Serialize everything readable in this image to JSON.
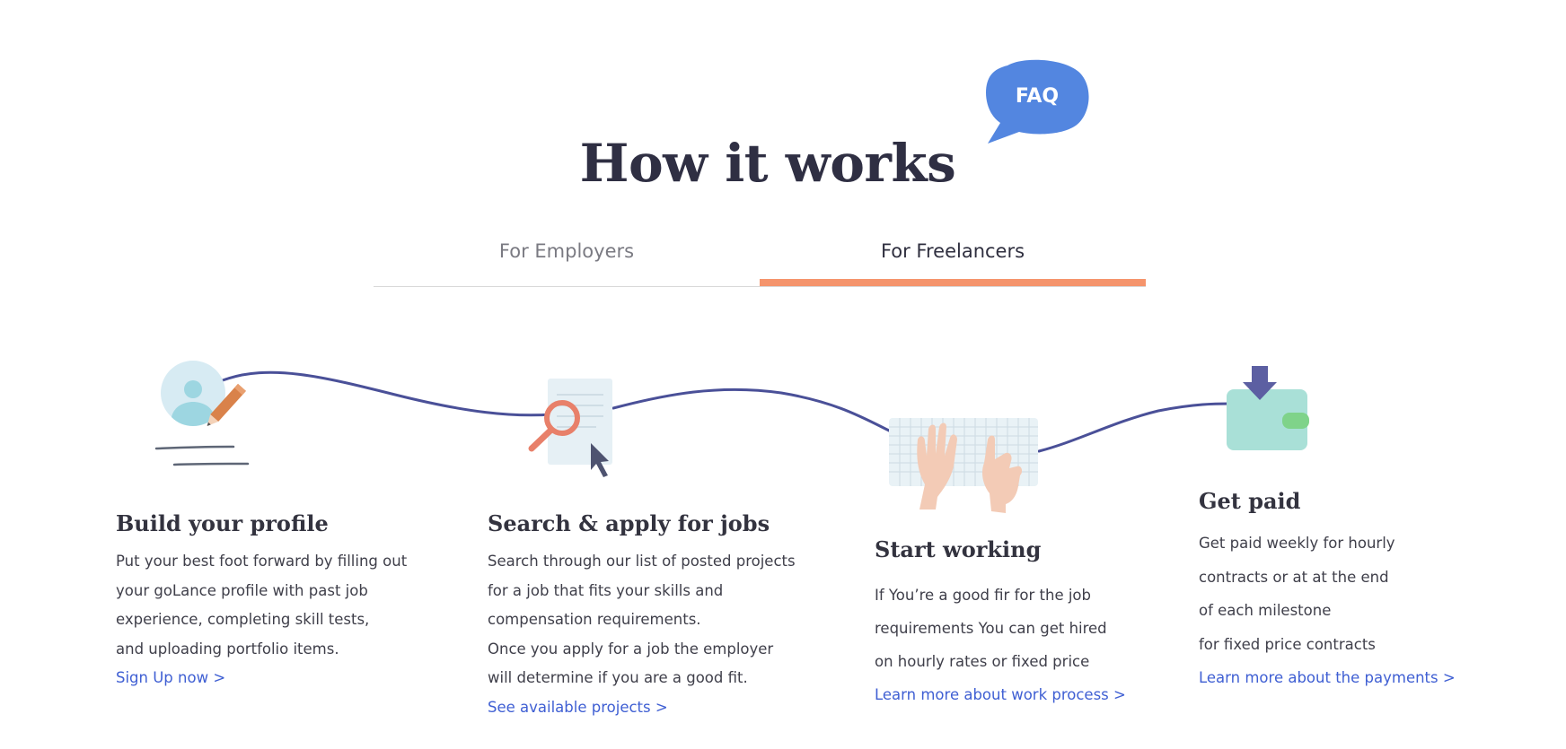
{
  "faq": {
    "label": "FAQ"
  },
  "page": {
    "title": "How it works"
  },
  "tabs": [
    {
      "label": "For Employers",
      "active": false
    },
    {
      "label": "For Freelancers",
      "active": true
    }
  ],
  "colors": {
    "accent": "#f5946c",
    "link": "#3f5fd3",
    "faq_bubble": "#5386e0",
    "title": "#2f2f43"
  },
  "steps": [
    {
      "icon": "profile-pencil-icon",
      "title": "Build your profile",
      "lines": [
        "Put your best foot forward by filling out",
        "your goLance profile with past job",
        "experience, completing skill tests,",
        "and uploading portfolio items."
      ],
      "link": "Sign Up now >"
    },
    {
      "icon": "document-search-icon",
      "title": "Search & apply for jobs",
      "lines": [
        "Search through our list of posted projects",
        "for a job that fits your skills and",
        "compensation requirements.",
        "Once you apply for a job the employer",
        "will determine if you are a good fit."
      ],
      "link": "See available projects >"
    },
    {
      "icon": "keyboard-hands-icon",
      "title": "Start working",
      "lines": [
        "If You’re a good fir for the job",
        "requirements You can get hired",
        "on hourly rates or fixed price"
      ],
      "link": "Learn more about work process >"
    },
    {
      "icon": "wallet-icon",
      "title": "Get paid",
      "lines": [
        "Get paid weekly for hourly",
        "contracts or at at the end",
        "of each milestone",
        "for fixed price contracts"
      ],
      "link": "Learn more about the payments >"
    }
  ]
}
